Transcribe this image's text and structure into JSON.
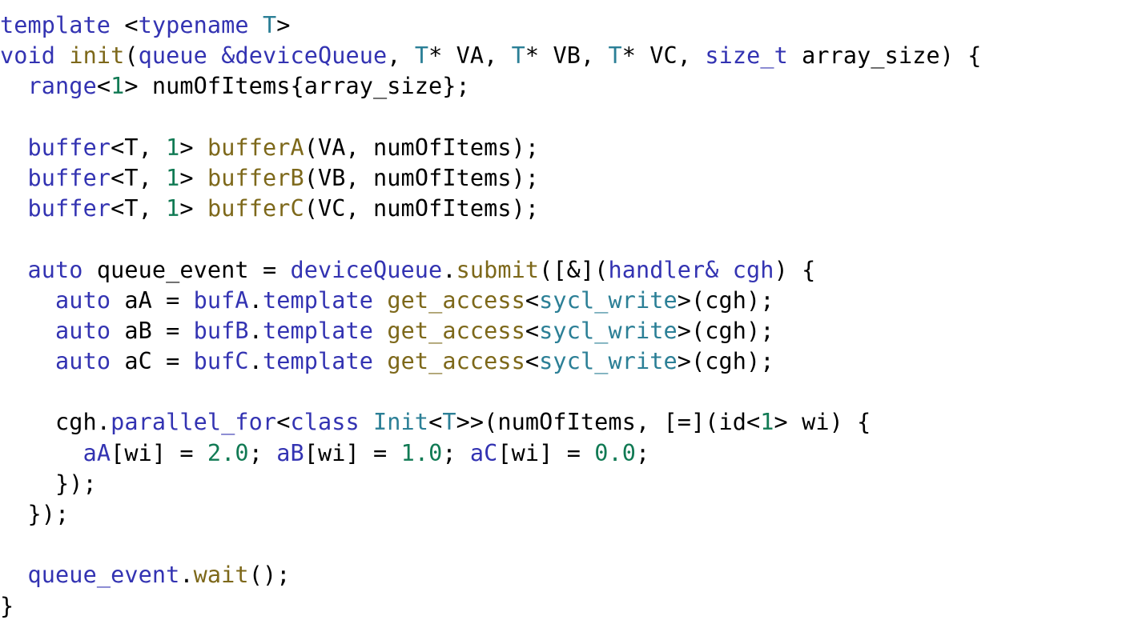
{
  "listing": {
    "language": "C++ (SYCL)",
    "background_color": "#ffffff",
    "colors": {
      "keyword": "#3333b2",
      "template_type": "#2b7f96",
      "function": "#7d681a",
      "number": "#117a54",
      "plain": "#000000"
    },
    "lines": [
      {
        "n": 1,
        "text": "template <typename T>",
        "tokens": [
          {
            "t": "template",
            "c": "kw"
          },
          {
            "t": " ",
            "c": "pun"
          },
          {
            "t": "<",
            "c": "pun"
          },
          {
            "t": "typename",
            "c": "kw"
          },
          {
            "t": " ",
            "c": "pun"
          },
          {
            "t": "T",
            "c": "type"
          },
          {
            "t": ">",
            "c": "pun"
          }
        ]
      },
      {
        "n": 2,
        "text": "void init(queue &deviceQueue, T* VA, T* VB, T* VC, size_t array_size) {",
        "tokens": [
          {
            "t": "void",
            "c": "kw"
          },
          {
            "t": " ",
            "c": "pun"
          },
          {
            "t": "init",
            "c": "fn"
          },
          {
            "t": "(",
            "c": "pun"
          },
          {
            "t": "queue",
            "c": "kw"
          },
          {
            "t": " ",
            "c": "pun"
          },
          {
            "t": "&deviceQueue",
            "c": "kw"
          },
          {
            "t": ", ",
            "c": "pun"
          },
          {
            "t": "T",
            "c": "type"
          },
          {
            "t": "* VA, ",
            "c": "pun"
          },
          {
            "t": "T",
            "c": "type"
          },
          {
            "t": "* VB, ",
            "c": "pun"
          },
          {
            "t": "T",
            "c": "type"
          },
          {
            "t": "* VC, ",
            "c": "pun"
          },
          {
            "t": "size_t",
            "c": "kw"
          },
          {
            "t": " array_size) {",
            "c": "pun"
          }
        ]
      },
      {
        "n": 3,
        "text": "  range<1> numOfItems{array_size};",
        "tokens": [
          {
            "t": "  ",
            "c": "pun"
          },
          {
            "t": "range",
            "c": "kw"
          },
          {
            "t": "<",
            "c": "pun"
          },
          {
            "t": "1",
            "c": "num"
          },
          {
            "t": "> numOfItems{array_size};",
            "c": "pun"
          }
        ]
      },
      {
        "n": 4,
        "text": "",
        "tokens": []
      },
      {
        "n": 5,
        "text": "  buffer<T, 1> bufferA(VA, numOfItems);",
        "tokens": [
          {
            "t": "  ",
            "c": "pun"
          },
          {
            "t": "buffer",
            "c": "kw"
          },
          {
            "t": "<T, ",
            "c": "pun"
          },
          {
            "t": "1",
            "c": "num"
          },
          {
            "t": "> ",
            "c": "pun"
          },
          {
            "t": "bufferA",
            "c": "fn"
          },
          {
            "t": "(VA, numOfItems);",
            "c": "pun"
          }
        ]
      },
      {
        "n": 6,
        "text": "  buffer<T, 1> bufferB(VB, numOfItems);",
        "tokens": [
          {
            "t": "  ",
            "c": "pun"
          },
          {
            "t": "buffer",
            "c": "kw"
          },
          {
            "t": "<T, ",
            "c": "pun"
          },
          {
            "t": "1",
            "c": "num"
          },
          {
            "t": "> ",
            "c": "pun"
          },
          {
            "t": "bufferB",
            "c": "fn"
          },
          {
            "t": "(VB, numOfItems);",
            "c": "pun"
          }
        ]
      },
      {
        "n": 7,
        "text": "  buffer<T, 1> bufferC(VC, numOfItems);",
        "tokens": [
          {
            "t": "  ",
            "c": "pun"
          },
          {
            "t": "buffer",
            "c": "kw"
          },
          {
            "t": "<T, ",
            "c": "pun"
          },
          {
            "t": "1",
            "c": "num"
          },
          {
            "t": "> ",
            "c": "pun"
          },
          {
            "t": "bufferC",
            "c": "fn"
          },
          {
            "t": "(VC, numOfItems);",
            "c": "pun"
          }
        ]
      },
      {
        "n": 8,
        "text": "",
        "tokens": []
      },
      {
        "n": 9,
        "text": "  auto queue_event = deviceQueue.submit([&](handler& cgh) {",
        "tokens": [
          {
            "t": "  ",
            "c": "pun"
          },
          {
            "t": "auto",
            "c": "kw"
          },
          {
            "t": " queue_event = ",
            "c": "pun"
          },
          {
            "t": "deviceQueue",
            "c": "kw"
          },
          {
            "t": ".",
            "c": "pun"
          },
          {
            "t": "submit",
            "c": "fn"
          },
          {
            "t": "([&](",
            "c": "pun"
          },
          {
            "t": "handler&",
            "c": "kw"
          },
          {
            "t": " ",
            "c": "pun"
          },
          {
            "t": "cgh",
            "c": "kw"
          },
          {
            "t": ") {",
            "c": "pun"
          }
        ]
      },
      {
        "n": 10,
        "text": "    auto aA = bufA.template get_access<sycl_write>(cgh);",
        "tokens": [
          {
            "t": "    ",
            "c": "pun"
          },
          {
            "t": "auto",
            "c": "kw"
          },
          {
            "t": " aA = ",
            "c": "pun"
          },
          {
            "t": "bufA",
            "c": "kw"
          },
          {
            "t": ".",
            "c": "pun"
          },
          {
            "t": "template",
            "c": "kw"
          },
          {
            "t": " ",
            "c": "pun"
          },
          {
            "t": "get_access",
            "c": "fn"
          },
          {
            "t": "<",
            "c": "pun"
          },
          {
            "t": "sycl_write",
            "c": "type"
          },
          {
            "t": ">(cgh);",
            "c": "pun"
          }
        ]
      },
      {
        "n": 11,
        "text": "    auto aB = bufB.template get_access<sycl_write>(cgh);",
        "tokens": [
          {
            "t": "    ",
            "c": "pun"
          },
          {
            "t": "auto",
            "c": "kw"
          },
          {
            "t": " aB = ",
            "c": "pun"
          },
          {
            "t": "bufB",
            "c": "kw"
          },
          {
            "t": ".",
            "c": "pun"
          },
          {
            "t": "template",
            "c": "kw"
          },
          {
            "t": " ",
            "c": "pun"
          },
          {
            "t": "get_access",
            "c": "fn"
          },
          {
            "t": "<",
            "c": "pun"
          },
          {
            "t": "sycl_write",
            "c": "type"
          },
          {
            "t": ">(cgh);",
            "c": "pun"
          }
        ]
      },
      {
        "n": 12,
        "text": "    auto aC = bufC.template get_access<sycl_write>(cgh);",
        "tokens": [
          {
            "t": "    ",
            "c": "pun"
          },
          {
            "t": "auto",
            "c": "kw"
          },
          {
            "t": " aC = ",
            "c": "pun"
          },
          {
            "t": "bufC",
            "c": "kw"
          },
          {
            "t": ".",
            "c": "pun"
          },
          {
            "t": "template",
            "c": "kw"
          },
          {
            "t": " ",
            "c": "pun"
          },
          {
            "t": "get_access",
            "c": "fn"
          },
          {
            "t": "<",
            "c": "pun"
          },
          {
            "t": "sycl_write",
            "c": "type"
          },
          {
            "t": ">(cgh);",
            "c": "pun"
          }
        ]
      },
      {
        "n": 13,
        "text": "",
        "tokens": []
      },
      {
        "n": 14,
        "text": "    cgh.parallel_for<class Init<T>>(numOfItems, [=](id<1> wi) {",
        "tokens": [
          {
            "t": "    cgh.",
            "c": "pun"
          },
          {
            "t": "parallel_for",
            "c": "kw"
          },
          {
            "t": "<",
            "c": "pun"
          },
          {
            "t": "class",
            "c": "kw"
          },
          {
            "t": " ",
            "c": "pun"
          },
          {
            "t": "Init",
            "c": "type"
          },
          {
            "t": "<",
            "c": "pun"
          },
          {
            "t": "T",
            "c": "type"
          },
          {
            "t": ">>(numOfItems, [=](id<",
            "c": "pun"
          },
          {
            "t": "1",
            "c": "num"
          },
          {
            "t": "> wi) {",
            "c": "pun"
          }
        ]
      },
      {
        "n": 15,
        "text": "      aA[wi] = 2.0; aB[wi] = 1.0; aC[wi] = 0.0;",
        "tokens": [
          {
            "t": "      ",
            "c": "pun"
          },
          {
            "t": "aA",
            "c": "kw"
          },
          {
            "t": "[wi] = ",
            "c": "pun"
          },
          {
            "t": "2.0",
            "c": "num"
          },
          {
            "t": "; ",
            "c": "pun"
          },
          {
            "t": "aB",
            "c": "kw"
          },
          {
            "t": "[wi] = ",
            "c": "pun"
          },
          {
            "t": "1.0",
            "c": "num"
          },
          {
            "t": "; ",
            "c": "pun"
          },
          {
            "t": "aC",
            "c": "kw"
          },
          {
            "t": "[wi] = ",
            "c": "pun"
          },
          {
            "t": "0.0",
            "c": "num"
          },
          {
            "t": ";",
            "c": "pun"
          }
        ]
      },
      {
        "n": 16,
        "text": "    });",
        "tokens": [
          {
            "t": "    });",
            "c": "pun"
          }
        ]
      },
      {
        "n": 17,
        "text": "  });",
        "tokens": [
          {
            "t": "  });",
            "c": "pun"
          }
        ]
      },
      {
        "n": 18,
        "text": "",
        "tokens": []
      },
      {
        "n": 19,
        "text": "  queue_event.wait();",
        "tokens": [
          {
            "t": "  ",
            "c": "pun"
          },
          {
            "t": "queue_event",
            "c": "kw"
          },
          {
            "t": ".",
            "c": "pun"
          },
          {
            "t": "wait",
            "c": "fn"
          },
          {
            "t": "();",
            "c": "pun"
          }
        ]
      },
      {
        "n": 20,
        "text": "}",
        "tokens": [
          {
            "t": "}",
            "c": "pun"
          }
        ]
      }
    ]
  }
}
